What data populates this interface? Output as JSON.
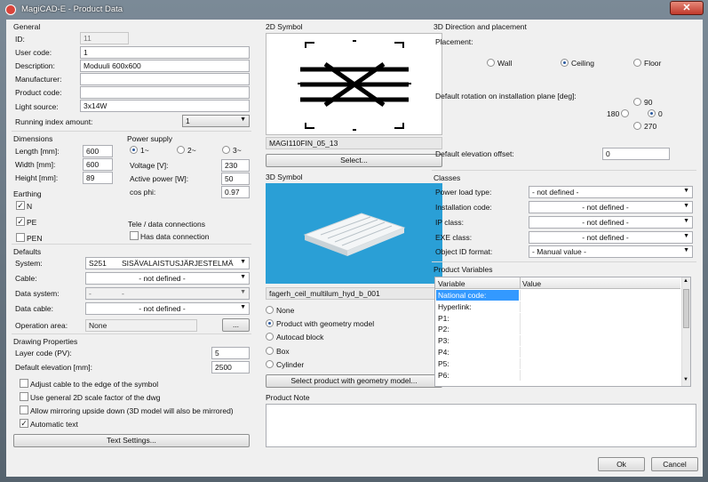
{
  "window": {
    "title": "MagiCAD-E - Product Data",
    "close_glyph": "✕"
  },
  "general": {
    "title": "General",
    "id_label": "ID:",
    "id_value": "11",
    "user_code_label": "User code:",
    "user_code_value": "1",
    "description_label": "Description:",
    "description_value": "Moduuli 600x600",
    "manufacturer_label": "Manufacturer:",
    "manufacturer_value": "",
    "product_code_label": "Product code:",
    "product_code_value": "",
    "light_source_label": "Light source:",
    "light_source_value": "3x14W",
    "running_index_label": "Running index amount:",
    "running_index_value": "1"
  },
  "dimensions": {
    "title": "Dimensions",
    "length_label": "Length [mm]:",
    "length_value": "600",
    "width_label": "Width [mm]:",
    "width_value": "600",
    "height_label": "Height [mm]:",
    "height_value": "89"
  },
  "power_supply": {
    "title": "Power supply",
    "phase_options": [
      "1~",
      "2~",
      "3~"
    ],
    "phase_selected": "1~",
    "voltage_label": "Voltage [V]:",
    "voltage_value": "230",
    "active_power_label": "Active power [W]:",
    "active_power_value": "50",
    "cosphi_label": "cos phi:",
    "cosphi_value": "0.97"
  },
  "earthing": {
    "title": "Earthing",
    "n_label": "N",
    "n_checked": true,
    "pe_label": "PE",
    "pe_checked": true,
    "pen_label": "PEN",
    "pen_checked": false
  },
  "tele": {
    "title": "Tele / data connections",
    "has_data_label": "Has data connection",
    "has_data_checked": false
  },
  "defaults": {
    "title": "Defaults",
    "system_label": "System:",
    "system_code": "S251",
    "system_name": "SISÄVALAISTUSJÄRJESTELMÄ",
    "cable_label": "Cable:",
    "cable_value": "- not defined -",
    "data_system_label": "Data system:",
    "data_system_code": "-",
    "data_system_name": "-",
    "data_cable_label": "Data cable:",
    "data_cable_value": "- not defined -",
    "operation_area_label": "Operation area:",
    "operation_area_value": "None",
    "operation_area_button": "..."
  },
  "drawing_properties": {
    "title": "Drawing Properties",
    "layer_code_label": "Layer code (PV):",
    "layer_code_value": "5",
    "default_elevation_label": "Default elevation [mm]:",
    "default_elevation_value": "2500",
    "checks": [
      {
        "label": "Adjust cable to the edge of the symbol",
        "checked": false
      },
      {
        "label": "Use general 2D scale factor of the dwg",
        "checked": false
      },
      {
        "label": "Allow mirroring upside down (3D model will also be mirrored)",
        "checked": false
      },
      {
        "label": "Automatic text",
        "checked": true
      }
    ],
    "text_settings_button": "Text Settings..."
  },
  "symbol_2d": {
    "title": "2D Symbol",
    "name": "MAGI110FIN_05_13",
    "select_button": "Select..."
  },
  "symbol_3d": {
    "title": "3D Symbol",
    "name": "fagerh_ceil_multilum_hyd_b_001",
    "options": [
      "None",
      "Product with geometry model",
      "Autocad block",
      "Box",
      "Cylinder"
    ],
    "selected": "Product with geometry model",
    "select_button": "Select product with geometry model...",
    "preview_color": "#2a9fd6"
  },
  "product_note": {
    "title": "Product Note",
    "value": ""
  },
  "direction": {
    "title": "3D Direction and placement",
    "placement_label": "Placement:",
    "placement_options": [
      "Wall",
      "Ceiling",
      "Floor"
    ],
    "placement_selected": "Ceiling",
    "rotation_label": "Default rotation on installation plane [deg]:",
    "rot_90": "90",
    "rot_180": "180",
    "rot_0": "0",
    "rot_270": "270",
    "rotation_selected": "0",
    "elevation_offset_label": "Default elevation offset:",
    "elevation_offset_value": "0"
  },
  "classes": {
    "title": "Classes",
    "power_load_label": "Power load type:",
    "power_load_value": "- not defined -",
    "installation_label": "Installation code:",
    "installation_value": "- not defined -",
    "ip_label": "IP class:",
    "ip_value": "- not defined -",
    "exe_label": "EXE class:",
    "exe_value": "- not defined -",
    "object_id_label": "Object ID format:",
    "object_id_value": "- Manual value -"
  },
  "product_variables": {
    "title": "Product Variables",
    "col_variable": "Variable",
    "col_value": "Value",
    "rows": [
      "National code:",
      "Hyperlink:",
      "P1:",
      "P2:",
      "P3:",
      "P4:",
      "P5:",
      "P6:"
    ],
    "selected_row": "National code:"
  },
  "footer": {
    "ok_button": "Ok",
    "cancel_button": "Cancel"
  }
}
